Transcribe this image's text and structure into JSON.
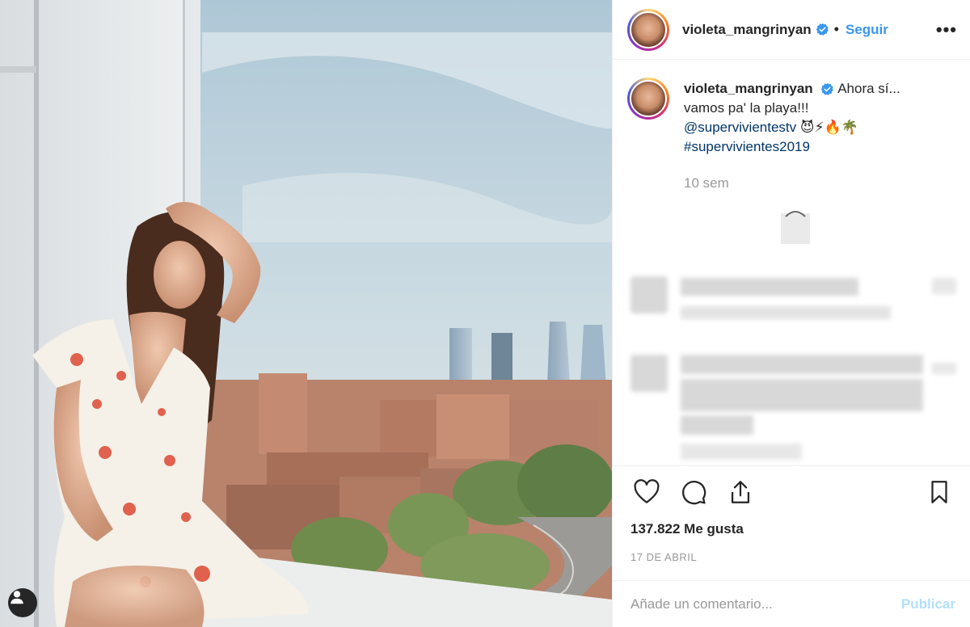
{
  "post": {
    "image_alt": "Mujer con vestido blanco de flores en un balcón con vistas a las torres de Madrid",
    "user_tag_icon": "person-icon"
  },
  "header": {
    "username": "violeta_mangrinyan",
    "verified_icon": "verified-badge-icon",
    "separator": "•",
    "follow_label": "Seguir",
    "more_label": "•••"
  },
  "caption": {
    "username": "violeta_mangrinyan",
    "text_line1": "Ahora sí...",
    "text_line2": "vamos pa' la playa!!!",
    "mention": "@supervivientestv",
    "emojis": "😈⚡🔥🌴",
    "hashtag": "#supervivientes2019",
    "time": "10 sem"
  },
  "actions": {
    "like_icon": "heart-icon",
    "comment_icon": "comment-bubble-icon",
    "share_icon": "share-icon",
    "save_icon": "bookmark-icon",
    "likes_text": "137.822 Me gusta",
    "date": "17 DE ABRIL"
  },
  "comment_input": {
    "placeholder": "Añade un comentario...",
    "publish_label": "Publicar"
  },
  "colors": {
    "accent": "#3897f0",
    "publish_disabled": "#b2dffc",
    "muted": "#999999",
    "text": "#262626"
  }
}
